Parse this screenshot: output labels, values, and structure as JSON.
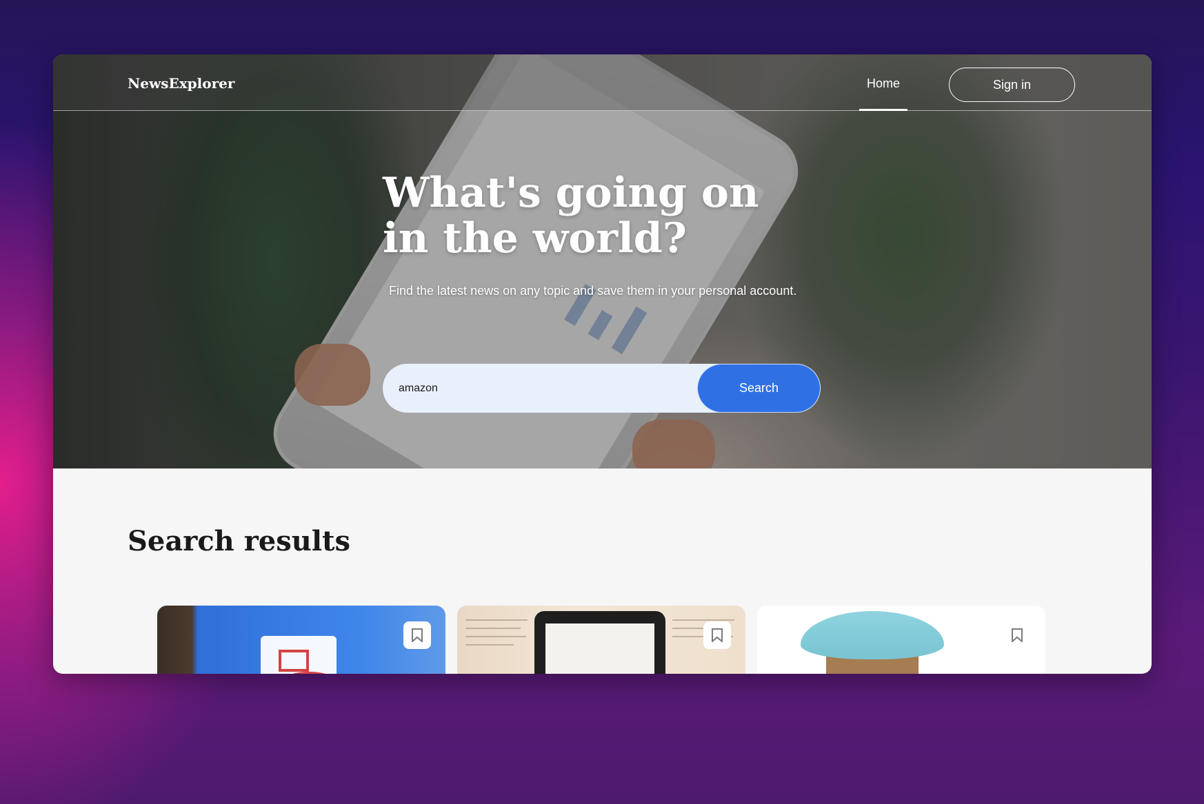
{
  "header": {
    "logo": "NewsExplorer",
    "nav_home": "Home",
    "signin": "Sign in"
  },
  "hero": {
    "headline": "What's going on in the world?",
    "subhead": "Find the latest news on any topic and save them in your personal account.",
    "search": {
      "value": "amazon",
      "button": "Search"
    }
  },
  "results": {
    "title": "Search results",
    "cards": [
      {
        "image": "tv-basketball",
        "bookmark_icon": "bookmark-icon"
      },
      {
        "image": "kindle-book",
        "bookmark_icon": "bookmark-icon"
      },
      {
        "image": "bird-feeder",
        "bookmark_icon": "bookmark-icon"
      }
    ]
  },
  "colors": {
    "accent": "#2f71e5",
    "input_bg": "#e8f0fc",
    "results_bg": "#f6f6f6"
  }
}
